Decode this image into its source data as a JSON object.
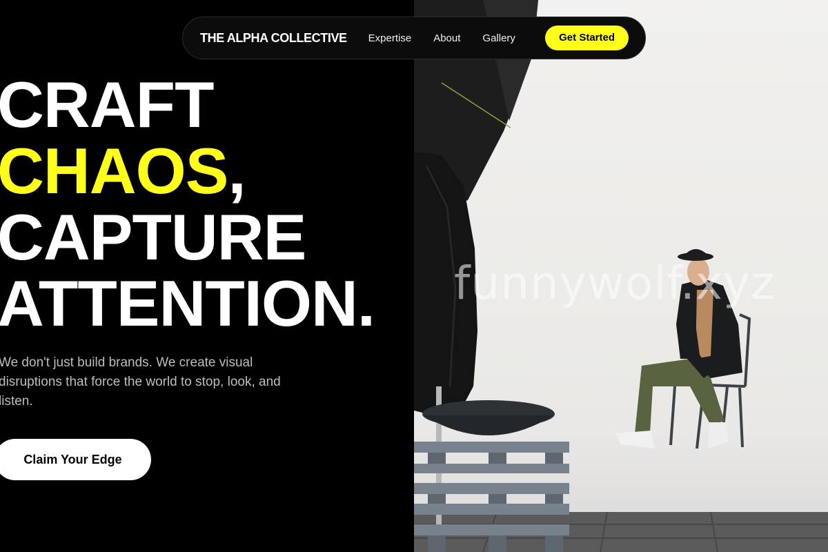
{
  "nav": {
    "brand": "THE ALPHA COLLECTIVE",
    "links": [
      "Expertise",
      "About",
      "Gallery"
    ],
    "cta_label": "Get Started"
  },
  "hero": {
    "line1": "CRAFT",
    "line2_accent": "CHAOS",
    "line2_rest": ",",
    "line3": "CAPTURE",
    "line4": "ATTENTION.",
    "subtext": "We don't just build brands. We create visual disruptions that force the world to stop, look, and listen.",
    "button_label": "Claim Your Edge"
  },
  "photo": {
    "watermark": "funnywolf.xyz"
  },
  "colors": {
    "accent": "#ffff1a",
    "background": "#000000",
    "text": "#ffffff",
    "muted": "#bdbdbd"
  }
}
